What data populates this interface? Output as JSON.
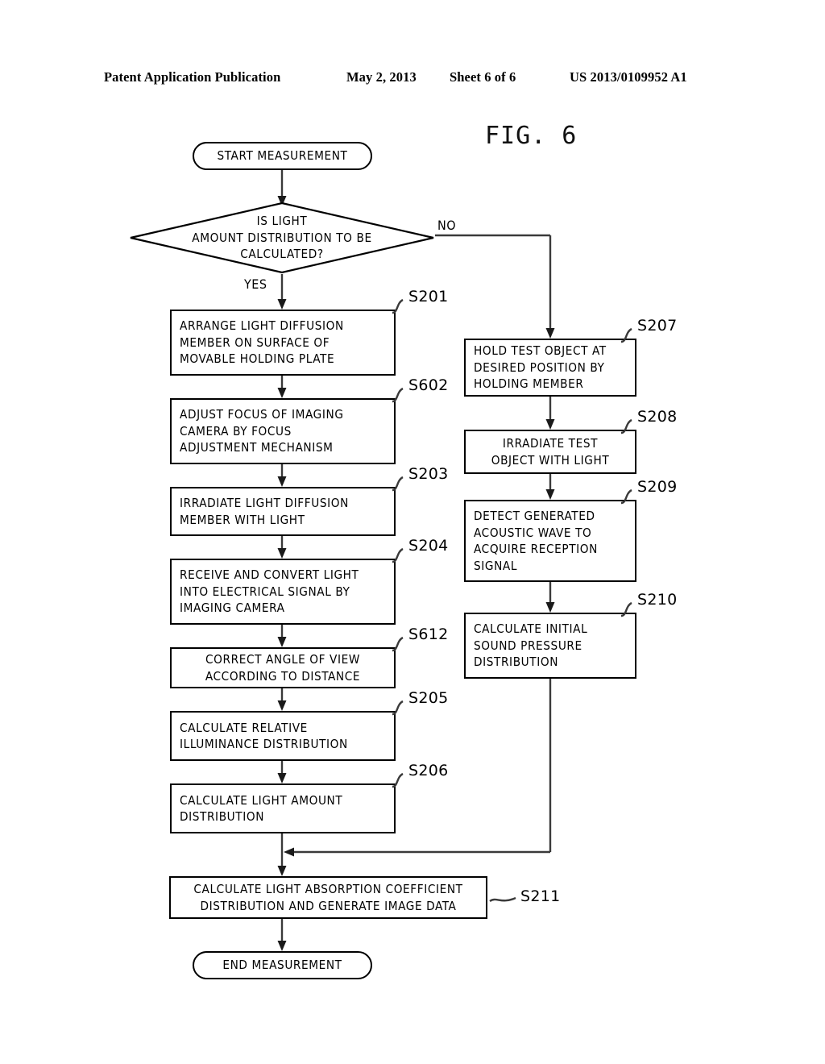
{
  "header": {
    "publication": "Patent Application Publication",
    "date": "May 2, 2013",
    "sheet": "Sheet 6 of 6",
    "number": "US 2013/0109952 A1"
  },
  "figure": {
    "label": "FIG. 6"
  },
  "flowchart": {
    "start": {
      "text": "START MEASUREMENT"
    },
    "decision": {
      "text": "IS LIGHT\nAMOUNT DISTRIBUTION TO BE\nCALCULATED?",
      "yes_label": "YES",
      "no_label": "NO"
    },
    "left_branch": [
      {
        "tag": "S201",
        "text": "ARRANGE LIGHT DIFFUSION\nMEMBER ON SURFACE OF\nMOVABLE HOLDING PLATE"
      },
      {
        "tag": "S602",
        "text": "ADJUST FOCUS OF IMAGING\nCAMERA BY FOCUS\nADJUSTMENT MECHANISM"
      },
      {
        "tag": "S203",
        "text": "IRRADIATE LIGHT DIFFUSION\nMEMBER WITH LIGHT"
      },
      {
        "tag": "S204",
        "text": "RECEIVE AND CONVERT LIGHT\nINTO ELECTRICAL SIGNAL BY\nIMAGING CAMERA"
      },
      {
        "tag": "S612",
        "text": "CORRECT ANGLE OF VIEW\nACCORDING TO DISTANCE"
      },
      {
        "tag": "S205",
        "text": "CALCULATE RELATIVE\nILLUMINANCE DISTRIBUTION"
      },
      {
        "tag": "S206",
        "text": "CALCULATE LIGHT AMOUNT\nDISTRIBUTION"
      }
    ],
    "right_branch": [
      {
        "tag": "S207",
        "text": "HOLD TEST OBJECT AT\nDESIRED POSITION BY\nHOLDING MEMBER"
      },
      {
        "tag": "S208",
        "text": "IRRADIATE TEST\nOBJECT WITH LIGHT"
      },
      {
        "tag": "S209",
        "text": "DETECT GENERATED\nACOUSTIC WAVE TO\nACQUIRE RECEPTION\nSIGNAL"
      },
      {
        "tag": "S210",
        "text": "CALCULATE INITIAL\nSOUND PRESSURE\nDISTRIBUTION"
      }
    ],
    "merge_step": {
      "tag": "S211",
      "text": "CALCULATE LIGHT ABSORPTION COEFFICIENT\nDISTRIBUTION AND GENERATE IMAGE DATA"
    },
    "end": {
      "text": "END MEASUREMENT"
    }
  },
  "colors": {
    "ink": "#000000",
    "connector": "#3a3a3a",
    "background": "#ffffff"
  }
}
